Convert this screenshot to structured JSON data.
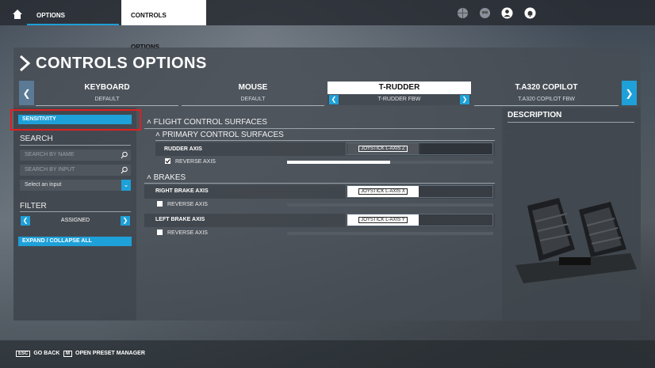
{
  "top_nav": {
    "options_label": "OPTIONS",
    "controls_options_label": "CONTROLS OPTIONS"
  },
  "page_title": "CONTROLS OPTIONS",
  "devices": [
    {
      "name": "KEYBOARD",
      "preset": "DEFAULT"
    },
    {
      "name": "MOUSE",
      "preset": "DEFAULT"
    },
    {
      "name": "T-RUDDER",
      "preset": "T-RUDDER FBW"
    },
    {
      "name": "T.A320 COPILOT",
      "preset": "T.A320 COPILOT FBW"
    }
  ],
  "left": {
    "sensitivity_button": "SENSITIVITY",
    "search_title": "SEARCH",
    "search_by_name_placeholder": "SEARCH BY NAME",
    "search_by_input_placeholder": "SEARCH BY INPUT",
    "select_input_value": "Select an input",
    "filter_title": "FILTER",
    "filter_value": "ASSIGNED",
    "expand_collapse_button": "EXPAND / COLLAPSE ALL"
  },
  "middle": {
    "group_flight": "FLIGHT CONTROL SURFACES",
    "subgroup_primary": "PRIMARY CONTROL SURFACES",
    "rudder_axis_label": "RUDDER AXIS",
    "rudder_binding": "JOYSTICK L-AXIS Z",
    "reverse_axis_label": "REVERSE AXIS",
    "rudder_reverse_checked": true,
    "rudder_slider_fraction": 0.5,
    "group_brakes": "BRAKES",
    "right_brake_label": "RIGHT BRAKE AXIS",
    "right_brake_binding": "JOYSTICK L-AXIS X",
    "left_brake_label": "LEFT BRAKE AXIS",
    "left_brake_binding": "JOYSTICK L-AXIS Y"
  },
  "description_title": "DESCRIPTION",
  "footer": {
    "go_back_key": "ESC",
    "go_back_label": "GO BACK",
    "preset_key": "M",
    "preset_label": "OPEN PRESET MANAGER"
  },
  "colors": {
    "accent": "#1ea0d8",
    "highlight_red": "#e02020"
  }
}
